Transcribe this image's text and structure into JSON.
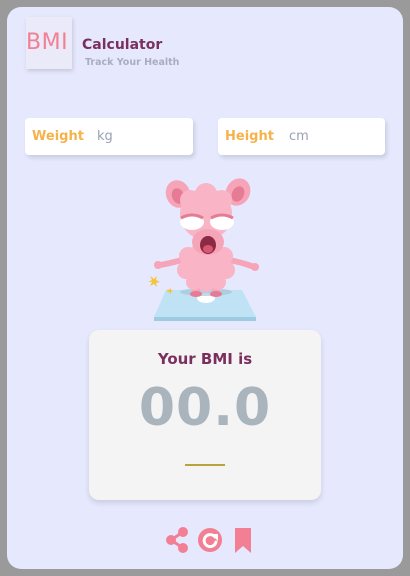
{
  "header": {
    "logo_text": "BMI",
    "title": "Calculator",
    "subtitle": "Track Your Health"
  },
  "inputs": {
    "weight": {
      "label": "Weight",
      "unit": "kg",
      "value": ""
    },
    "height": {
      "label": "Height",
      "unit": "cm",
      "value": ""
    }
  },
  "result": {
    "label": "Your BMI is",
    "value": "00.0"
  },
  "actions": {
    "share_icon": "share-icon",
    "reset_icon": "refresh-icon",
    "save_icon": "bookmark-icon"
  },
  "colors": {
    "background": "#e6e8fe",
    "accent_pink": "#f27f94",
    "label_orange": "#f6b24b",
    "title_purple": "#7a2f5f",
    "value_gray": "#a9b4bc"
  }
}
